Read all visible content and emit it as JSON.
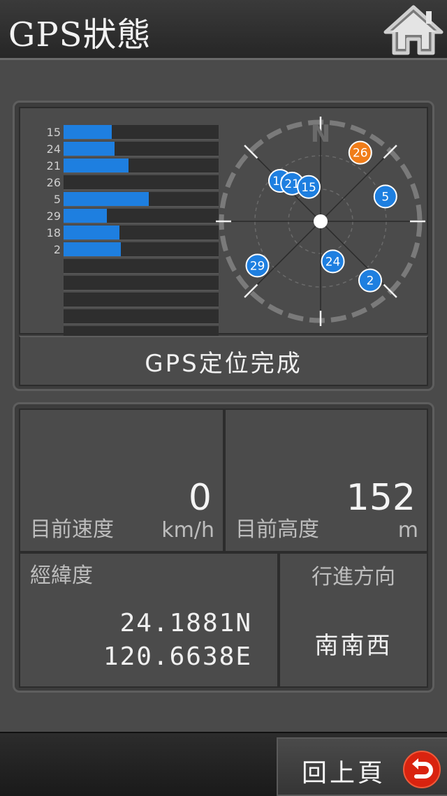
{
  "header": {
    "title": "GPS狀態"
  },
  "colors": {
    "accent": "#1e7fe0",
    "highlight": "#f07d19"
  },
  "satellite_panel": {
    "signal_bars": [
      {
        "id": "15",
        "strength": 0.31
      },
      {
        "id": "24",
        "strength": 0.33
      },
      {
        "id": "21",
        "strength": 0.42
      },
      {
        "id": "26",
        "strength": 0.0
      },
      {
        "id": "5",
        "strength": 0.55
      },
      {
        "id": "29",
        "strength": 0.28
      },
      {
        "id": "18",
        "strength": 0.36
      },
      {
        "id": "2",
        "strength": 0.37
      }
    ],
    "empty_rows": 5,
    "compass": {
      "north_label": "N",
      "satellites": [
        {
          "id": "18",
          "azimuth": 315,
          "elevation": 38,
          "highlight": false
        },
        {
          "id": "21",
          "azimuth": 323,
          "elevation": 47,
          "highlight": false
        },
        {
          "id": "15",
          "azimuth": 341,
          "elevation": 57,
          "highlight": false
        },
        {
          "id": "26",
          "azimuth": 30,
          "elevation": 18,
          "highlight": true
        },
        {
          "id": "5",
          "azimuth": 69,
          "elevation": 27,
          "highlight": false
        },
        {
          "id": "29",
          "azimuth": 235,
          "elevation": 20,
          "highlight": false
        },
        {
          "id": "24",
          "azimuth": 163,
          "elevation": 52,
          "highlight": false
        },
        {
          "id": "2",
          "azimuth": 140,
          "elevation": 20,
          "highlight": false
        }
      ]
    },
    "status": "GPS定位完成"
  },
  "info": {
    "speed": {
      "value": "0",
      "label": "目前速度",
      "unit": "km/h"
    },
    "altitude": {
      "value": "152",
      "label": "目前高度",
      "unit": "m"
    },
    "coords": {
      "label": "經緯度",
      "lat": "24.1881N",
      "lon": "120.6638E"
    },
    "heading": {
      "label": "行進方向",
      "value": "南南西"
    }
  },
  "footer": {
    "back_label": "回上頁"
  }
}
